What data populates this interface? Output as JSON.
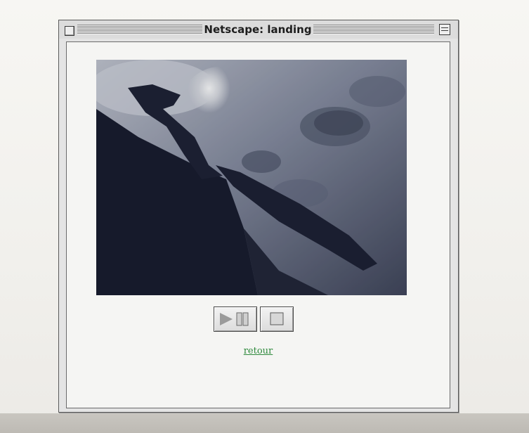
{
  "window": {
    "title": "Netscape: landing"
  },
  "player": {
    "frame_subject": "lunar surface with landing leg shadow",
    "play_pause_icon": "play-pause-icon",
    "stop_icon": "stop-icon"
  },
  "page": {
    "link_label": "retour",
    "link_color": "#2f8a3d"
  }
}
